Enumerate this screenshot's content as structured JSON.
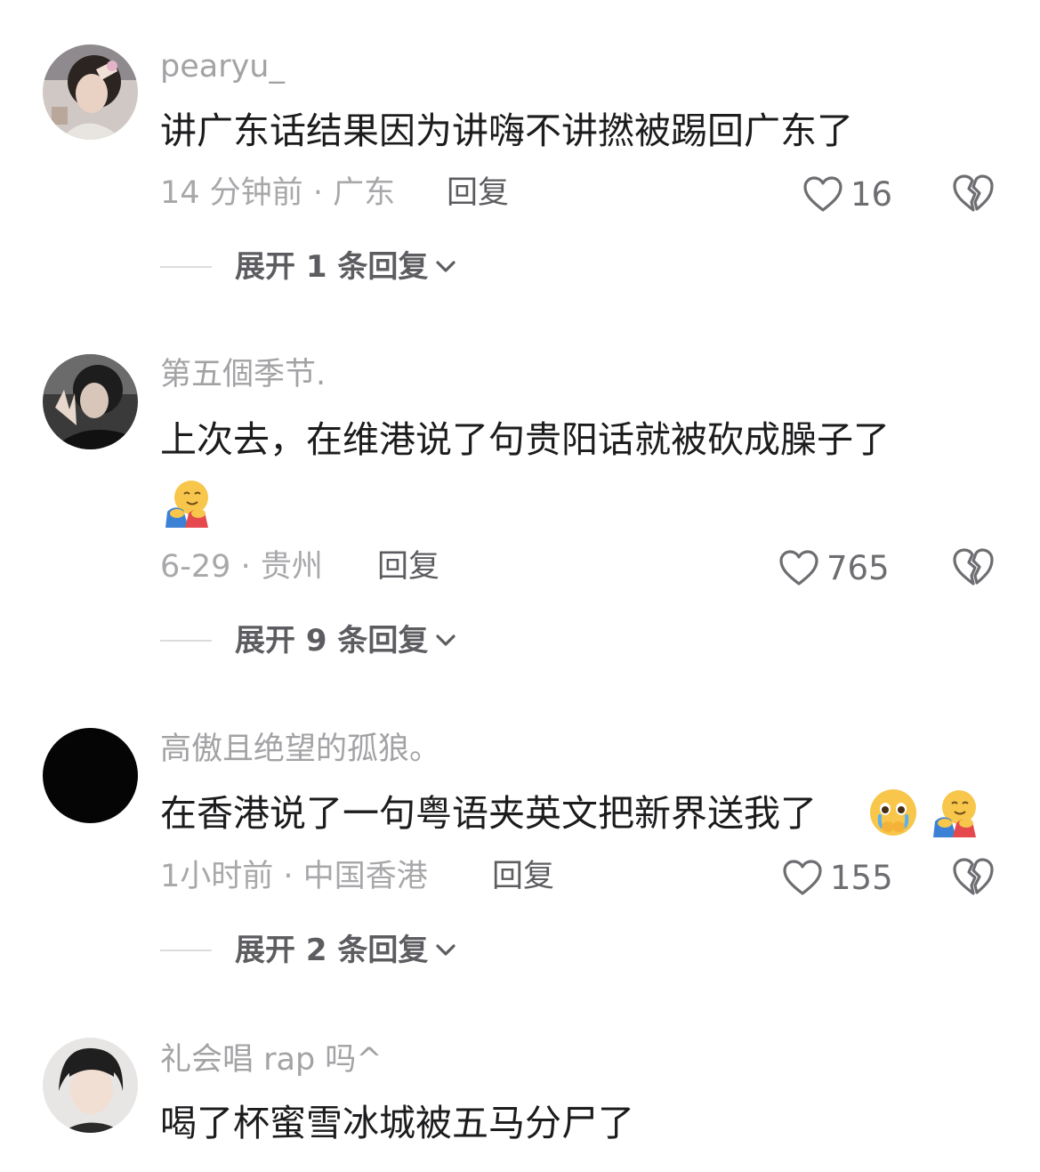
{
  "comments": [
    {
      "username": "pearyu_",
      "text": "讲广东话结果因为讲嗨不讲撚被踢回广东了",
      "time": "14 分钟前",
      "location": "广东",
      "reply": "回复",
      "likes": "16",
      "expand": "展开 1 条回复"
    },
    {
      "username": "第五個季节.",
      "text": "上次去，在维港说了句贵阳话就被砍成臊子了",
      "emoji_line": "hugging-face-emoji",
      "time": "6-29",
      "location": "贵州",
      "reply": "回复",
      "likes": "765",
      "expand": "展开 9 条回复"
    },
    {
      "username": "高傲且绝望的孤狼。",
      "text": "在香港说了一句粤语夹英文把新界送我了",
      "emojis": [
        "holding-back-tears-emoji",
        "hugging-face-emoji"
      ],
      "time": "1小时前",
      "location": "中国香港",
      "reply": "回复",
      "likes": "155",
      "expand": "展开 2 条回复"
    },
    {
      "username": "礼会唱 rap 吗^",
      "text": "喝了杯蜜雪冰城被五马分尸了"
    }
  ],
  "separator": "·",
  "colors": {
    "text": "#1c1c1e",
    "meta": "#a8a8ab",
    "username": "#a3a3a6",
    "icon": "#6e6e72"
  }
}
